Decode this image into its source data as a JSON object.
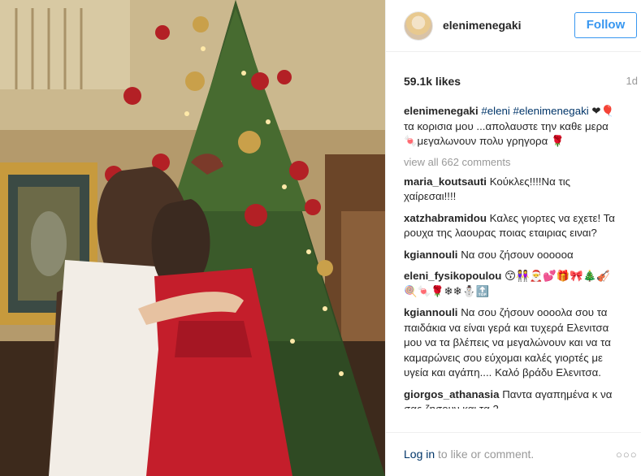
{
  "post": {
    "photo_alt": "photo"
  },
  "header": {
    "username": "elenimenegaki",
    "follow_label": "Follow"
  },
  "stats": {
    "likes": "59.1k likes",
    "time_ago": "1d"
  },
  "caption": {
    "username": "elenimenegaki",
    "tags": "#eleni #elenimenegaki",
    "text": "❤🎈τα κορισια μου ...απολαυστε την καθε μερα 🍬μεγαλωνουν πολυ γρηγορα 🌹"
  },
  "view_all": "view all 662 comments",
  "comments": [
    {
      "username": "maria_koutsauti",
      "text": "Κούκλες!!!!Να τις χαίρεσαι!!!!"
    },
    {
      "username": "xatzhabramidou",
      "text": "Καλες γιορτες να εχετε! Τα ρουχα της λαουρας ποιας εταιριας ειναι?"
    },
    {
      "username": "kgiannouli",
      "text": "Να σου ζήσουν οοοοοα"
    },
    {
      "username": "eleni_fysikopoulou",
      "text": "😙👭🎅💕🎁🎀🎄🎻🍭🍬🌹❄❄⛄🔝"
    },
    {
      "username": "kgiannouli",
      "text": "Να σου ζήσουν οοοολα σου τα παιδάκια να είναι γερά και τυχερά Ελενιτσα μου να τα βλέπεις να μεγαλώνουν και να τα καμαρώνεις σου εύχομαι καλές γιορτές με υγεία και αγάπη.... Καλό βράδυ Ελενιτσα."
    },
    {
      "username": "giorgos_athanasia",
      "text": "Παντα αγαπημένα κ να σας ζησουν και τα 2"
    }
  ],
  "footer": {
    "login_link": "Log in",
    "login_rest": " to like or comment.",
    "more_icon": "more-icon"
  }
}
